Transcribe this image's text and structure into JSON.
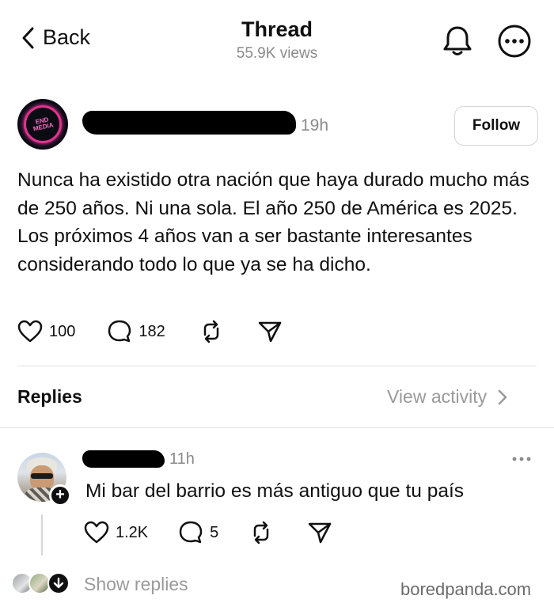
{
  "header": {
    "back_label": "Back",
    "title": "Thread",
    "views": "55.9K views",
    "icons": [
      "chevron-left-icon",
      "bell-icon",
      "more-icon"
    ]
  },
  "post": {
    "avatar_text": "END MEDIA",
    "time": "19h",
    "follow_label": "Follow",
    "text": "Nunca ha existido otra nación que haya durado mucho más de 250 años. Ni una sola. El año 250 de América es 2025. Los próximos 4 años van a ser bastante interesantes considerando todo lo que ya se ha dicho.",
    "likes": "100",
    "comments": "182",
    "icons": [
      "heart-icon",
      "comment-icon",
      "repost-icon",
      "share-icon"
    ]
  },
  "replies_section": {
    "title": "Replies",
    "view_activity": "View activity"
  },
  "reply": {
    "time": "11h",
    "text": "Mi bar del barrio es más antiguo que tu país",
    "likes": "1.2K",
    "comments": "5",
    "plus": "+"
  },
  "show_replies": "Show replies",
  "watermark": "boredpanda.com",
  "colors": {
    "text": "#101010",
    "muted": "#8a8a8a",
    "divider": "#e3e3e3",
    "redaction": "#000000"
  }
}
